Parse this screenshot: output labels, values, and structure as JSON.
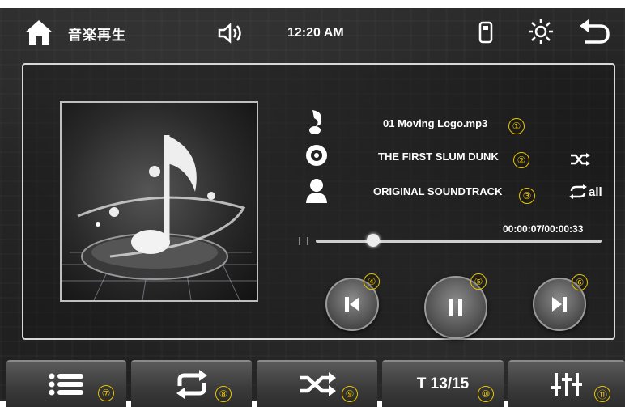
{
  "topbar": {
    "title": "音楽再生",
    "clock": "12:20 AM"
  },
  "track": {
    "filename": "01 Moving Logo.mp3",
    "album": "THE FIRST SLUM DUNK",
    "artist": "ORIGINAL SOUNDTRACK",
    "time": "00:00:07/00:00:33",
    "progress_fraction": 0.2,
    "repeat_mode_label": "all"
  },
  "markers": {
    "m1": "①",
    "m2": "②",
    "m3": "③",
    "m4": "④",
    "m5": "⑤",
    "m6": "⑥",
    "m7": "⑦",
    "m8": "⑧",
    "m9": "⑨",
    "m10": "⑩",
    "m11": "⑪"
  },
  "bottom": {
    "track_counter": "T 13/15"
  },
  "icons": {
    "home": "home-icon",
    "speaker": "speaker-icon",
    "usb": "usb-icon",
    "brightness": "brightness-icon",
    "back": "back-icon",
    "note": "music-note-icon",
    "disc": "disc-icon",
    "person": "artist-icon",
    "shuffle": "shuffle-icon",
    "repeat": "repeat-icon",
    "prev": "previous-icon",
    "pause": "pause-icon",
    "next": "next-icon",
    "list": "list-icon",
    "equalizer": "equalizer-icon"
  },
  "colors": {
    "marker": "#e8c400",
    "text": "#ffffff",
    "background": "#222222"
  }
}
